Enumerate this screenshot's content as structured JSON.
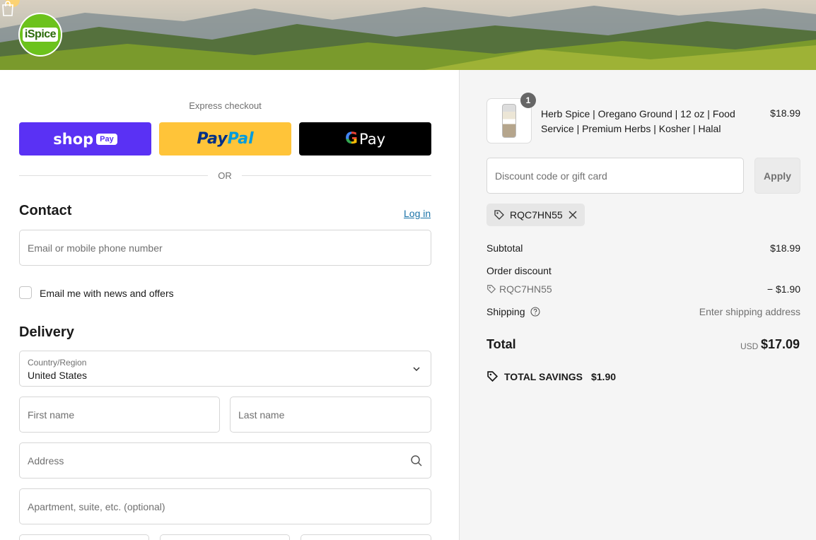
{
  "header": {
    "logo_text": "iSpice",
    "cart_icon": "shopping-bag-icon"
  },
  "express": {
    "label": "Express checkout",
    "shop_pay": {
      "word": "shop",
      "chip": "Pay"
    },
    "paypal": {
      "part1": "Pay",
      "part2": "Pal"
    },
    "gpay": {
      "g": "G",
      "word": "Pay"
    },
    "or_text": "OR"
  },
  "contact": {
    "title": "Contact",
    "login_link": "Log in",
    "email_placeholder": "Email or mobile phone number",
    "newsletter_label": "Email me with news and offers"
  },
  "delivery": {
    "title": "Delivery",
    "country_label": "Country/Region",
    "country_value": "United States",
    "first_name_placeholder": "First name",
    "last_name_placeholder": "Last name",
    "address_placeholder": "Address",
    "apartment_placeholder": "Apartment, suite, etc. (optional)"
  },
  "order": {
    "item": {
      "quantity": "1",
      "name": "Herb Spice | Oregano Ground | 12 oz | Food Service | Premium Herbs | Kosher | Halal",
      "price": "$18.99"
    },
    "discount_placeholder": "Discount code or gift card",
    "apply_label": "Apply",
    "applied_code": "RQC7HN55",
    "summary": {
      "subtotal_label": "Subtotal",
      "subtotal_value": "$18.99",
      "order_discount_label": "Order discount",
      "discount_code": "RQC7HN55",
      "discount_value": "− $1.90",
      "shipping_label": "Shipping",
      "shipping_value": "Enter shipping address",
      "total_label": "Total",
      "currency": "USD",
      "total_value": "$17.09",
      "savings_label": "TOTAL SAVINGS",
      "savings_value": "$1.90"
    }
  },
  "colors": {
    "shop_pay": "#5a31f4",
    "paypal": "#ffc439",
    "gpay": "#000000",
    "logo_green": "#6cc21c",
    "link": "#1a73a8"
  }
}
